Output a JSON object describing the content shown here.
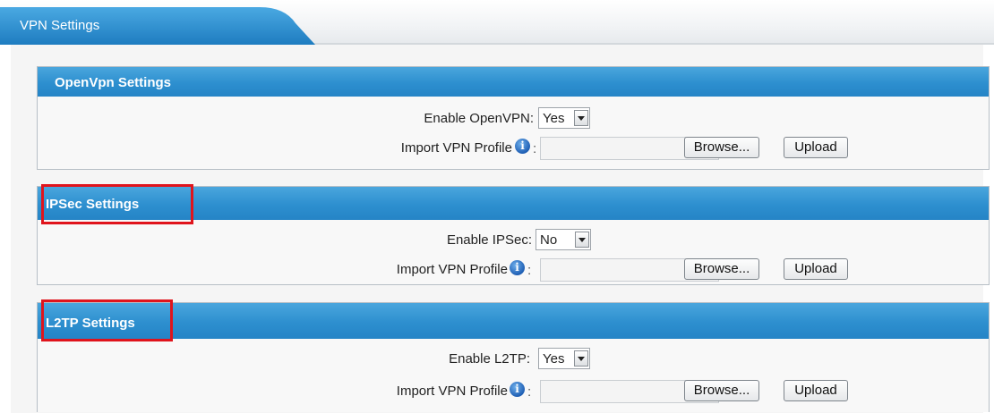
{
  "page": {
    "tab_label": "VPN Settings"
  },
  "sections": [
    {
      "title": "OpenVpn Settings",
      "enable_label": "Enable OpenVPN:",
      "enable_value": "Yes",
      "import_label": "Import VPN Profile",
      "colon": ":",
      "browse_label": "Browse...",
      "upload_label": "Upload",
      "highlighted": false
    },
    {
      "title": "IPSec Settings",
      "enable_label": "Enable IPSec:",
      "enable_value": "No",
      "import_label": "Import VPN Profile",
      "colon": ":",
      "browse_label": "Browse...",
      "upload_label": "Upload",
      "highlighted": true
    },
    {
      "title": "L2TP Settings",
      "enable_label": "Enable L2TP:",
      "enable_value": "Yes",
      "import_label": "Import VPN Profile",
      "colon": ":",
      "browse_label": "Browse...",
      "upload_label": "Upload",
      "highlighted": true
    }
  ],
  "icons": {
    "info": "info-icon",
    "dropdown": "chevron-down-icon"
  },
  "colors": {
    "header_blue": "#2d8fcf",
    "highlight_red": "#e0141c"
  }
}
